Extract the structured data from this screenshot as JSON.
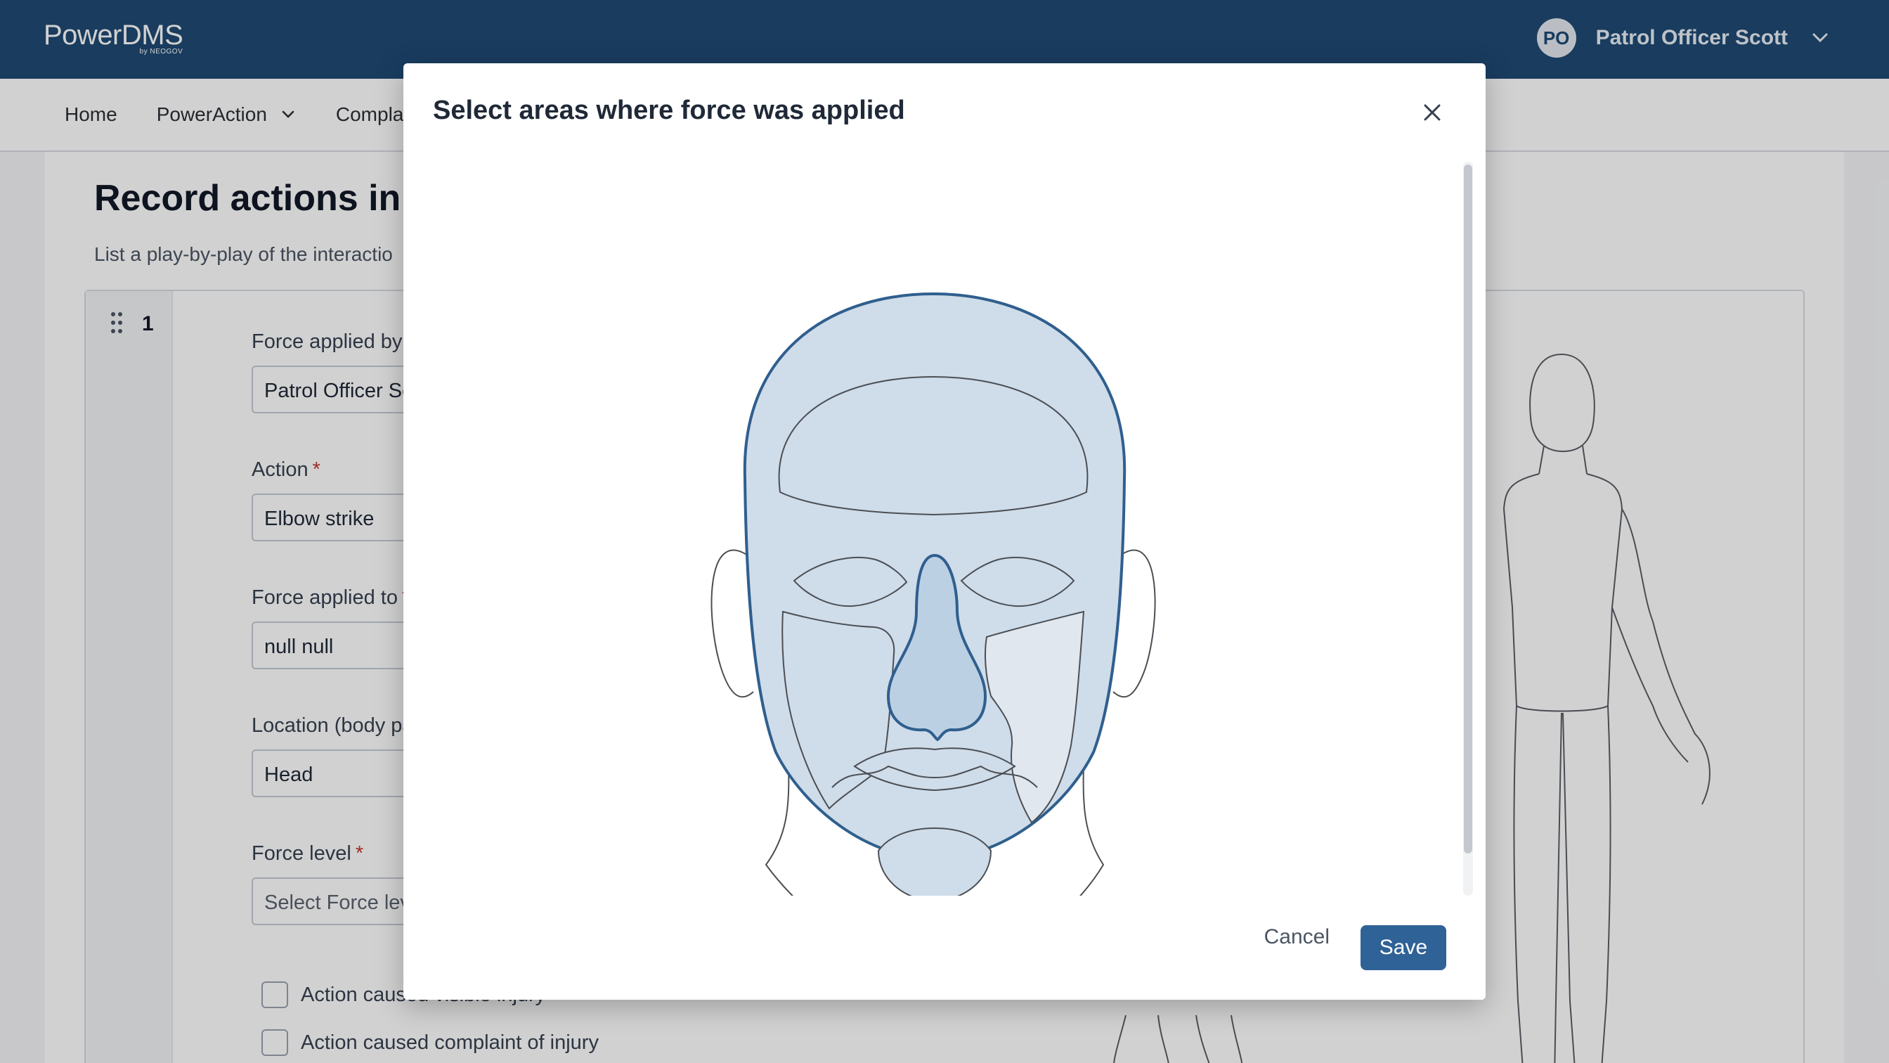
{
  "header": {
    "logo_text": "PowerDMS",
    "logo_subtext": "by NEOGOV",
    "user_initials": "PO",
    "user_name": "Patrol Officer Scott"
  },
  "nav": {
    "items": [
      {
        "label": "Home",
        "has_dropdown": false
      },
      {
        "label": "PowerAction",
        "has_dropdown": true
      },
      {
        "label": "Compla",
        "has_dropdown": false
      }
    ]
  },
  "page": {
    "title": "Record actions in se",
    "description": "List a play-by-play of the interactio",
    "step_number": "1",
    "fields": [
      {
        "label": "Force applied by",
        "required": true,
        "value": "Patrol Officer Scott",
        "is_placeholder": false
      },
      {
        "label": "Action",
        "required": true,
        "value": "Elbow strike",
        "is_placeholder": false
      },
      {
        "label": "Force applied to",
        "required": true,
        "value": "null null",
        "is_placeholder": false
      },
      {
        "label": "Location (body part)",
        "required": true,
        "value": "Head",
        "is_placeholder": false
      },
      {
        "label": "Force level",
        "required": true,
        "value": "Select Force level",
        "is_placeholder": true
      }
    ],
    "checkboxes": [
      {
        "label": "Action caused visible injury",
        "checked": false
      },
      {
        "label": "Action caused complaint of injury",
        "checked": false
      }
    ]
  },
  "modal": {
    "title": "Select areas where force was applied",
    "cancel_label": "Cancel",
    "save_label": "Save"
  },
  "colors": {
    "header_bg": "#1f4a74",
    "primary_button": "#2f6296",
    "region_fill": "#cfdce9",
    "region_selected": "#bcd0e4",
    "outline_dark": "#2f5f8e"
  },
  "icons": {
    "close": "close-icon",
    "dropdown": "chevron-down-icon",
    "drag": "drag-handle-icon"
  }
}
